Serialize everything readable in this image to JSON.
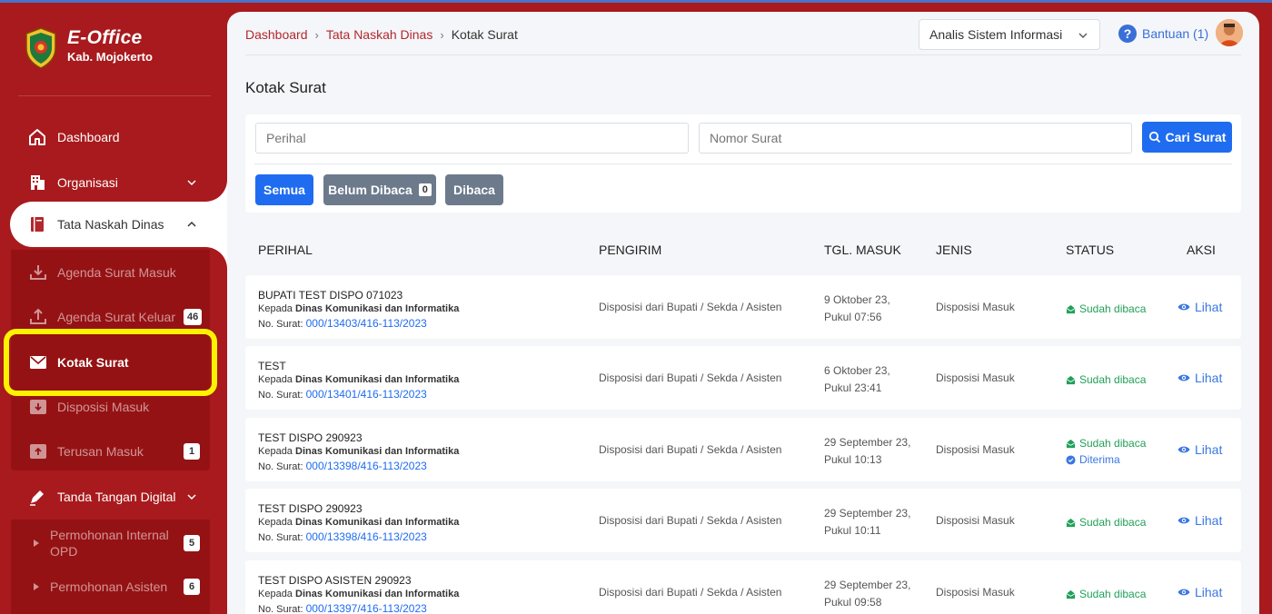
{
  "brand": {
    "title": "E-Office",
    "subtitle": "Kab. Mojokerto"
  },
  "sidebar": {
    "items": [
      {
        "label": "Dashboard",
        "icon": "home-icon"
      },
      {
        "label": "Organisasi",
        "icon": "building-icon"
      },
      {
        "label": "Tata Naskah Dinas",
        "icon": "book-icon"
      },
      {
        "label": "Tanda Tangan Digital",
        "icon": "pen-icon"
      }
    ],
    "sub_items": [
      {
        "label": "Agenda Surat Masuk",
        "icon": "download-tray-icon",
        "badge": ""
      },
      {
        "label": "Agenda Surat Keluar",
        "icon": "upload-tray-icon",
        "badge": "46"
      },
      {
        "label": "Kotak Surat",
        "icon": "envelope-icon",
        "badge": ""
      },
      {
        "label": "Disposisi Masuk",
        "icon": "inbox-down-icon",
        "badge": ""
      },
      {
        "label": "Terusan Masuk",
        "icon": "inbox-up-icon",
        "badge": "1"
      }
    ],
    "sign_items": [
      {
        "label_line1": "Permohonan Internal",
        "label_line2": "OPD",
        "badge": "5"
      },
      {
        "label_line1": "Permohonan Asisten",
        "label_line2": "",
        "badge": "6"
      }
    ]
  },
  "header": {
    "breadcrumb": [
      "Dashboard",
      "Tata Naskah Dinas",
      "Kotak Surat"
    ],
    "role": "Analis Sistem Informasi",
    "help_label": "Bantuan (1)"
  },
  "page_title": "Kotak Surat",
  "filters": {
    "perihal_placeholder": "Perihal",
    "nomor_placeholder": "Nomor Surat",
    "search_label": "Cari Surat",
    "chips": [
      {
        "label": "Semua"
      },
      {
        "label": "Belum Dibaca",
        "count": "0"
      },
      {
        "label": "Dibaca"
      }
    ]
  },
  "table": {
    "headers": [
      "PERIHAL",
      "PENGIRIM",
      "TGL. MASUK",
      "JENIS",
      "STATUS",
      "AKSI"
    ],
    "rows": [
      {
        "title": "BUPATI TEST DISPO 071023",
        "to_prefix": "Kepada",
        "to": "Dinas Komunikasi dan Informatika",
        "no_prefix": "No. Surat:",
        "no": "000/13403/416-113/2023",
        "from": "Disposisi dari Bupati / Sekda / Asisten",
        "date1": "9 Oktober 23,",
        "date2": "Pukul 07:56",
        "type": "Disposisi Masuk",
        "status1": "Sudah dibaca",
        "status2": "",
        "action": "Lihat"
      },
      {
        "title": "TEST",
        "to_prefix": "Kepada",
        "to": "Dinas Komunikasi dan Informatika",
        "no_prefix": "No. Surat:",
        "no": "000/13401/416-113/2023",
        "from": "Disposisi dari Bupati / Sekda / Asisten",
        "date1": "6 Oktober 23,",
        "date2": "Pukul 23:41",
        "type": "Disposisi Masuk",
        "status1": "Sudah dibaca",
        "status2": "",
        "action": "Lihat"
      },
      {
        "title": "TEST DISPO 290923",
        "to_prefix": "Kepada",
        "to": "Dinas Komunikasi dan Informatika",
        "no_prefix": "No. Surat:",
        "no": "000/13398/416-113/2023",
        "from": "Disposisi dari Bupati / Sekda / Asisten",
        "date1": "29 September 23,",
        "date2": "Pukul 10:13",
        "type": "Disposisi Masuk",
        "status1": "Sudah dibaca",
        "status2": "Diterima",
        "action": "Lihat"
      },
      {
        "title": "TEST DISPO 290923",
        "to_prefix": "Kepada",
        "to": "Dinas Komunikasi dan Informatika",
        "no_prefix": "No. Surat:",
        "no": "000/13398/416-113/2023",
        "from": "Disposisi dari Bupati / Sekda / Asisten",
        "date1": "29 September 23,",
        "date2": "Pukul 10:11",
        "type": "Disposisi Masuk",
        "status1": "Sudah dibaca",
        "status2": "",
        "action": "Lihat"
      },
      {
        "title": "TEST DISPO ASISTEN 290923",
        "to_prefix": "Kepada",
        "to": "Dinas Komunikasi dan Informatika",
        "no_prefix": "No. Surat:",
        "no": "000/13397/416-113/2023",
        "from": "Disposisi dari Bupati / Sekda / Asisten",
        "date1": "29 September 23,",
        "date2": "Pukul 09:58",
        "type": "Disposisi Masuk",
        "status1": "Sudah dibaca",
        "status2": "",
        "action": "Lihat"
      }
    ]
  },
  "colors": {
    "brand_red": "#a81a1d",
    "primary_blue": "#1f6cf0",
    "status_green": "#22a05a",
    "highlight_yellow": "#fff200"
  }
}
